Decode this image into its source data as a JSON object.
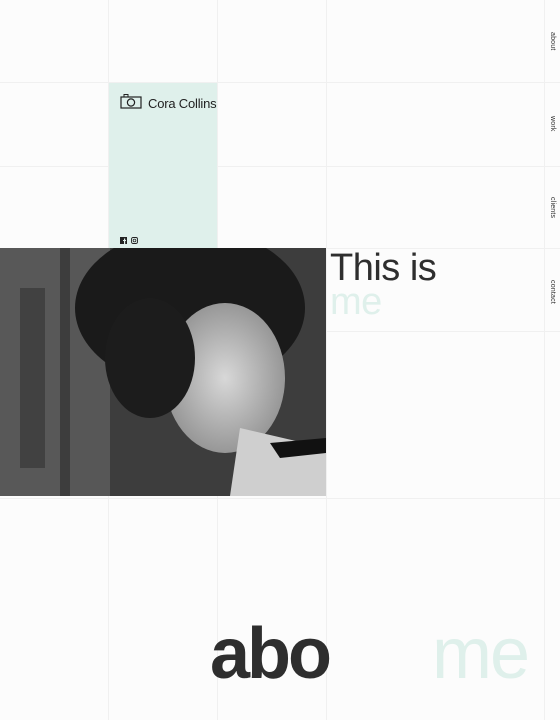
{
  "brand": {
    "name": "Cora Collins"
  },
  "nav": {
    "items": [
      "about",
      "work",
      "clients",
      "contact"
    ]
  },
  "hero": {
    "line1": "This is",
    "line2": "me"
  },
  "about": {
    "word1": "abo",
    "word2": "me"
  },
  "colors": {
    "mint": "#dff0eb",
    "text": "#2e2e2e"
  },
  "icons": [
    "camera-logo-icon",
    "facebook-icon",
    "instagram-icon"
  ]
}
